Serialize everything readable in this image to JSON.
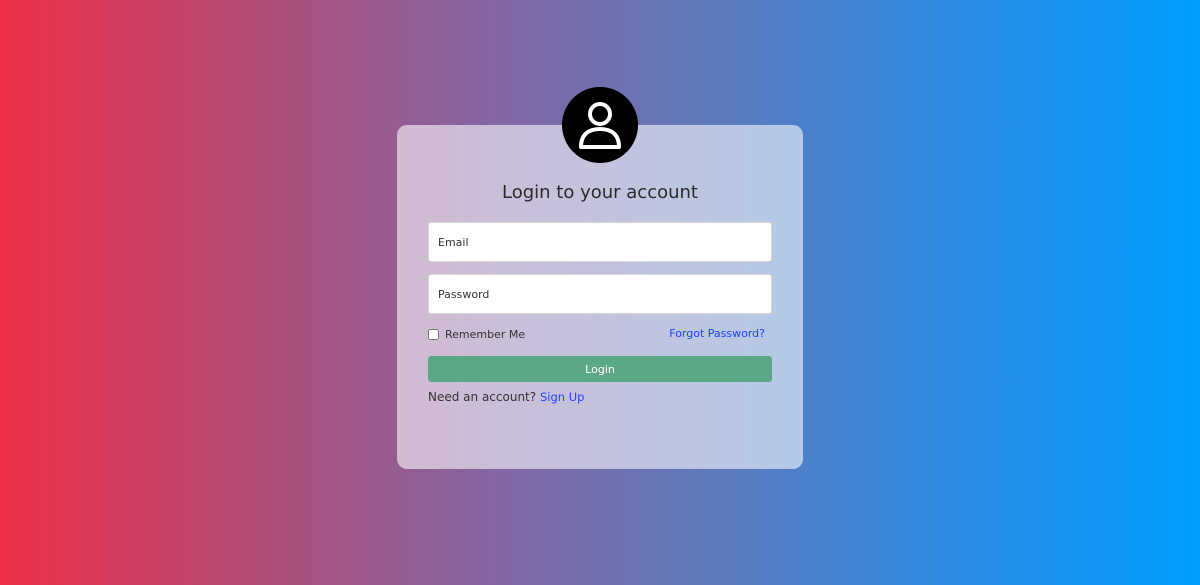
{
  "login": {
    "title": "Login to your account",
    "email_placeholder": "Email",
    "password_placeholder": "Password",
    "remember_label": "Remember Me",
    "forgot_label": "Forgot Password?",
    "login_label": "Login",
    "need_account_text": "Need an account?",
    "signup_label": "Sign Up"
  },
  "colors": {
    "gradient_start": "#f0304a",
    "gradient_end": "#009dff",
    "login_button": "#5aa886",
    "link": "#1e40ff"
  },
  "icons": {
    "avatar": "user-icon"
  }
}
